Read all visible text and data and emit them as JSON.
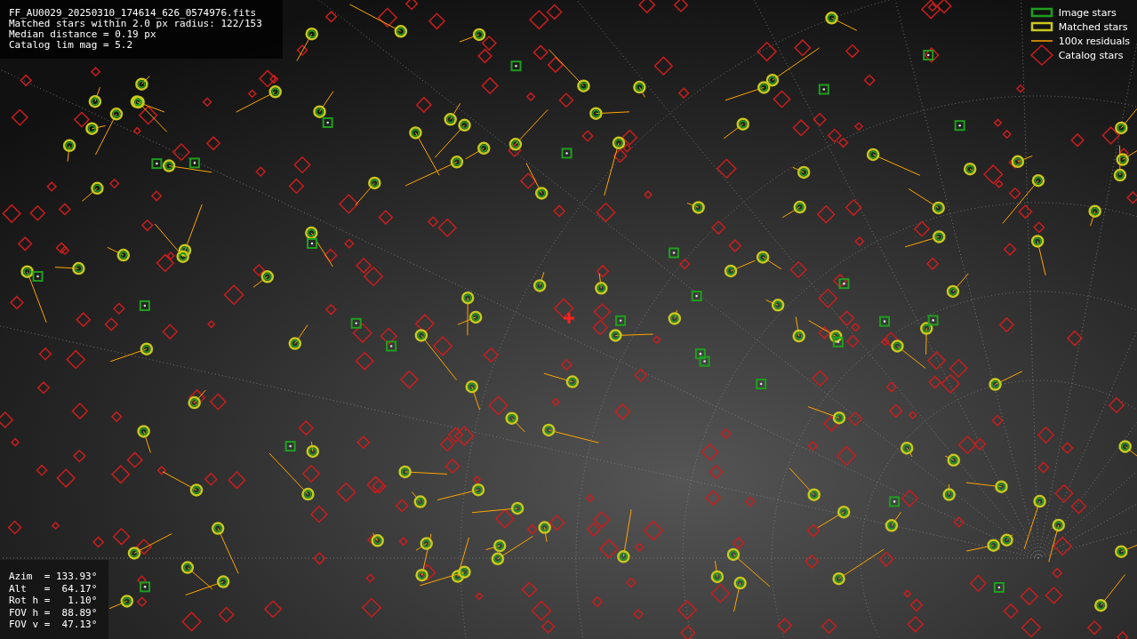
{
  "header": {
    "lines": [
      "FF_AU0029_20250310_174614_626_0574976.fits",
      "Matched stars within 2.0 px radius: 122/153",
      "Median distance = 0.19 px",
      "Catalog lim mag = 5.2"
    ]
  },
  "legend": [
    {
      "kind": "image",
      "label": "Image stars"
    },
    {
      "kind": "matched",
      "label": "Matched stars"
    },
    {
      "kind": "residual",
      "label": "100x residuals"
    },
    {
      "kind": "catalog",
      "label": "Catalog stars"
    }
  ],
  "pointing": {
    "lines": [
      "Azim  = 133.93°",
      "Alt   =  64.17°",
      "Rot h =   1.10°",
      "FOV h =  88.89°",
      "FOV v =  47.13°"
    ]
  }
}
